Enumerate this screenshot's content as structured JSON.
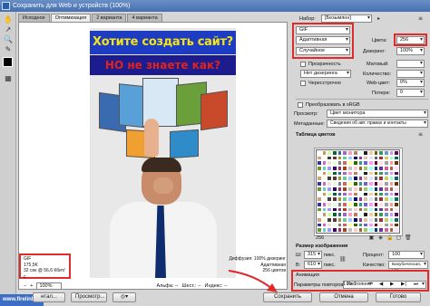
{
  "window": {
    "title": "Сохранить для Web и устройств (100%)"
  },
  "tabs": [
    {
      "label": "Исходное"
    },
    {
      "label": "Оптимизация"
    },
    {
      "label": "2 варианта"
    },
    {
      "label": "4 варианта"
    }
  ],
  "artwork": {
    "headline1": "Хотите создать сайт?",
    "headline2": "НО не знаете как?"
  },
  "info_left": {
    "format": "GIF",
    "size": "175,5K",
    "time": "32 сек @ 56,6 Кбит/с"
  },
  "info_right": {
    "dither": "Диффузия: 100% дизеринг",
    "palette": "Адаптивная",
    "colors": "256 цветов"
  },
  "bottom": {
    "zoom": "100%",
    "alpha": "Альфа: --",
    "hex": "Шест.: --",
    "index": "Индекс: --"
  },
  "footer": {
    "preview_browser": "Просмотр...",
    "save": "Сохранить",
    "cancel": "Отмена",
    "done": "Готово",
    "prev": "нтал...",
    "watermark": "www.firelinks.ru"
  },
  "panel": {
    "preset_label": "Набор:",
    "preset_value": "[Безымянн]",
    "format_value": "GIF",
    "reduction": "Адаптивная",
    "colors_label": "Цвета:",
    "colors_value": "256",
    "dither_algo": "Случайное",
    "dither_label": "Дизеринг:",
    "dither_value": "100%",
    "transparency": "Прозрачность",
    "matte_label": "Матовый:",
    "no_dither": "Нет дизеринга",
    "amount_label": "Количество:",
    "interlaced": "Чересстрочно",
    "web_snap_label": "Web-цвет:",
    "web_snap_value": "0%",
    "lossy_label": "Потери:",
    "lossy_value": "0",
    "convert_srgb": "Преобразовать в sRGB",
    "preview_label": "Просмотр:",
    "preview_value": "Цвет монитора",
    "metadata_label": "Метаданные:",
    "metadata_value": "Сведения об авт. правах и контакты",
    "color_table_title": "Таблица цветов",
    "color_count": "256",
    "image_size_title": "Размер изображения",
    "width_label": "Ш:",
    "width_value": "315",
    "height_label": "В:",
    "height_value": "610",
    "px": "пикс.",
    "percent_label": "Процент:",
    "percent_value": "100",
    "quality_label": "Качество:",
    "quality_value": "Бикубическая, чет...",
    "animation_title": "Анимация",
    "loop_label": "Параметры повторов:",
    "loop_value": "Постоянно",
    "frame_counter": "1 из 1"
  },
  "palette_colors": [
    "#ffffff",
    "#ffcccc",
    "#ff9999",
    "#cc6666",
    "#993333",
    "#663333",
    "#ffcc99",
    "#cc9966",
    "#996633",
    "#663300",
    "#ffff99",
    "#cccc66",
    "#999933",
    "#666600",
    "#ccff99",
    "#99cc66",
    "#669933",
    "#336600",
    "#99ffcc",
    "#66cc99",
    "#339966",
    "#006633",
    "#99ffff",
    "#66cccc",
    "#339999",
    "#006666",
    "#99ccff",
    "#6699cc",
    "#336699",
    "#003366",
    "#9999ff",
    "#6666cc",
    "#333399",
    "#000066",
    "#cc99ff",
    "#9966cc",
    "#663399",
    "#330066",
    "#ff99ff",
    "#cc66cc",
    "#993399",
    "#660066",
    "#ff99cc",
    "#cc6699",
    "#993366",
    "#660033",
    "#f0e0d0",
    "#e0c0a0",
    "#d0a080",
    "#c08060",
    "#b06040",
    "#a04020",
    "#ffe0e0",
    "#e0ffe0",
    "#e0e0ff",
    "#ffffe0",
    "#e0ffff",
    "#ffe0ff",
    "#c0c0c0",
    "#a0a0a0",
    "#808080",
    "#606060",
    "#404040",
    "#202020"
  ]
}
